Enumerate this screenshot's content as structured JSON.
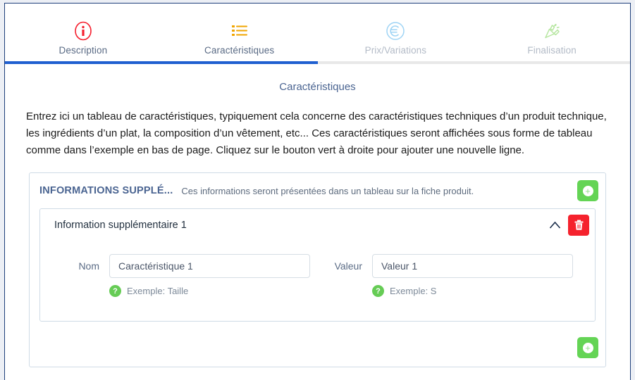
{
  "tabs": [
    {
      "label": "Description",
      "icon": "info-circle-icon",
      "state": "active-done"
    },
    {
      "label": "Caractéristiques",
      "icon": "list-icon",
      "state": "current"
    },
    {
      "label": "Prix/Variations",
      "icon": "euro-circle-icon",
      "state": "inactive"
    },
    {
      "label": "Finalisation",
      "icon": "party-popper-icon",
      "state": "inactive"
    }
  ],
  "progress": {
    "percent": 50,
    "fill_color": "#1f5fd0",
    "track_color": "#e8e8e8"
  },
  "page": {
    "title": "Caractéristiques",
    "intro": "Entrez ici un tableau de caractéristiques, typiquement cela concerne des caractéristiques techniques d’un produit technique, les ingrédients d’un plat, la composition d’un vêtement, etc... Ces caractéristiques seront affichées sous forme de tableau comme dans l’exemple en bas de page. Cliquez sur le bouton vert à droite pour ajouter une nouvelle ligne."
  },
  "panel": {
    "title": "INFORMATIONS SUPPLÉ...",
    "subtitle": "Ces informations seront présentées dans un tableau sur la fiche produit.",
    "add_button_label": "+",
    "add_button_color": "#64d455",
    "footer_add_button_label": "+"
  },
  "card": {
    "title": "Information supplémentaire 1",
    "collapse_icon": "chevron-up-icon",
    "delete_icon": "trash-icon",
    "delete_button_color": "#f5222d",
    "fields": [
      {
        "label": "Nom",
        "value": "Caractéristique 1",
        "placeholder": "Caractéristique 1",
        "hint": "Exemple: Taille",
        "hint_badge": "?"
      },
      {
        "label": "Valeur",
        "value": "Valeur 1",
        "placeholder": "Valeur 1",
        "hint": "Exemple: S",
        "hint_badge": "?"
      }
    ]
  }
}
